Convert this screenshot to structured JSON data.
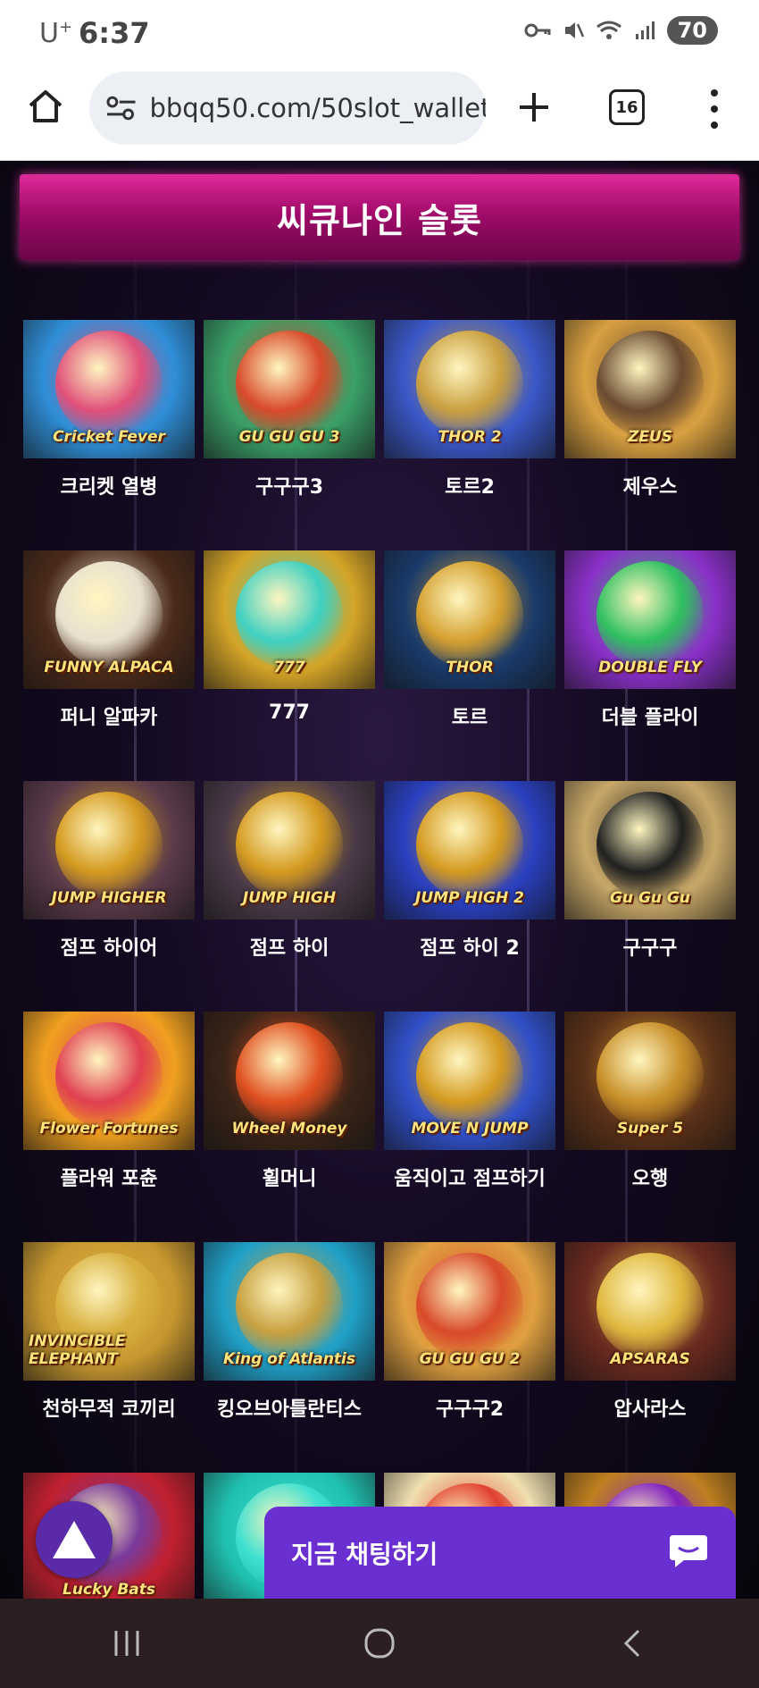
{
  "status": {
    "carrier": "U",
    "carrier_sup": "+",
    "time": "6:37",
    "battery": "70"
  },
  "browser": {
    "url": "bbqq50.com/50slot_wallet",
    "tab_count": "16"
  },
  "section_title": "씨큐나인 슬롯",
  "games": [
    {
      "title": "크리켓 열병",
      "logo": "Cricket Fever",
      "bg": "#2f8fd8",
      "orb": "#e0507a"
    },
    {
      "title": "구구구3",
      "logo": "GU GU GU 3",
      "bg": "#3aa068",
      "orb": "#d84a2a"
    },
    {
      "title": "토르2",
      "logo": "THOR 2",
      "bg": "#3a58c8",
      "orb": "#caa040"
    },
    {
      "title": "제우스",
      "logo": "ZEUS",
      "bg": "#d8a040",
      "orb": "#6a4a30"
    },
    {
      "title": "퍼니 알파카",
      "logo": "FUNNY ALPACA",
      "bg": "#4a2a1a",
      "orb": "#e8e0d0"
    },
    {
      "title": "777",
      "logo": "777",
      "bg": "#d4a428",
      "orb": "#40d0c0"
    },
    {
      "title": "토르",
      "logo": "THOR",
      "bg": "#1a3a6a",
      "orb": "#d4a030"
    },
    {
      "title": "더블 플라이",
      "logo": "DOUBLE FLY",
      "bg": "#8a30c8",
      "orb": "#30c060"
    },
    {
      "title": "점프 하이어",
      "logo": "JUMP HIGHER",
      "bg": "#5a3a4a",
      "orb": "#d49a20"
    },
    {
      "title": "점프 하이",
      "logo": "JUMP HIGH",
      "bg": "#4a3a48",
      "orb": "#d49a20"
    },
    {
      "title": "점프 하이 2",
      "logo": "JUMP HIGH 2",
      "bg": "#2a40c0",
      "orb": "#d49a20"
    },
    {
      "title": "구구구",
      "logo": "Gu Gu Gu",
      "bg": "#c8a868",
      "orb": "#202020"
    },
    {
      "title": "플라워 포츈",
      "logo": "Flower Fortunes",
      "bg": "#f0a020",
      "orb": "#e04050"
    },
    {
      "title": "휠머니",
      "logo": "Wheel Money",
      "bg": "#3a2418",
      "orb": "#e05020"
    },
    {
      "title": "움직이고 점프하기",
      "logo": "MOVE N JUMP",
      "bg": "#3050c8",
      "orb": "#d49a20"
    },
    {
      "title": "오행",
      "logo": "Super 5",
      "bg": "#5a3018",
      "orb": "#c8902a"
    },
    {
      "title": "천하무적 코끼리",
      "logo": "INVINCIBLE ELEPHANT",
      "bg": "#c89830",
      "orb": "#d8b040"
    },
    {
      "title": "킹오브아틀란티스",
      "logo": "King of Atlantis",
      "bg": "#20a0c8",
      "orb": "#c8a040"
    },
    {
      "title": "구구구2",
      "logo": "GU GU GU 2",
      "bg": "#e0a040",
      "orb": "#d84a2a"
    },
    {
      "title": "압사라스",
      "logo": "APSARAS",
      "bg": "#6a2a20",
      "orb": "#e0b840"
    },
    {
      "title": "",
      "logo": "Lucky Bats",
      "bg": "#c02030",
      "orb": "#7a3a9a"
    },
    {
      "title": "",
      "logo": "",
      "bg": "#20c0b0",
      "orb": "#40e0d0"
    },
    {
      "title": "",
      "logo": "",
      "bg": "#f0e0b0",
      "orb": "#e04030"
    },
    {
      "title": "",
      "logo": "",
      "bg": "#c08020",
      "orb": "#8020c0"
    }
  ],
  "chat": {
    "label": "지금 채팅하기"
  },
  "colors": {
    "banner": "#c0177f",
    "chat": "#6a2fd0",
    "navbar": "#2b1f22"
  }
}
